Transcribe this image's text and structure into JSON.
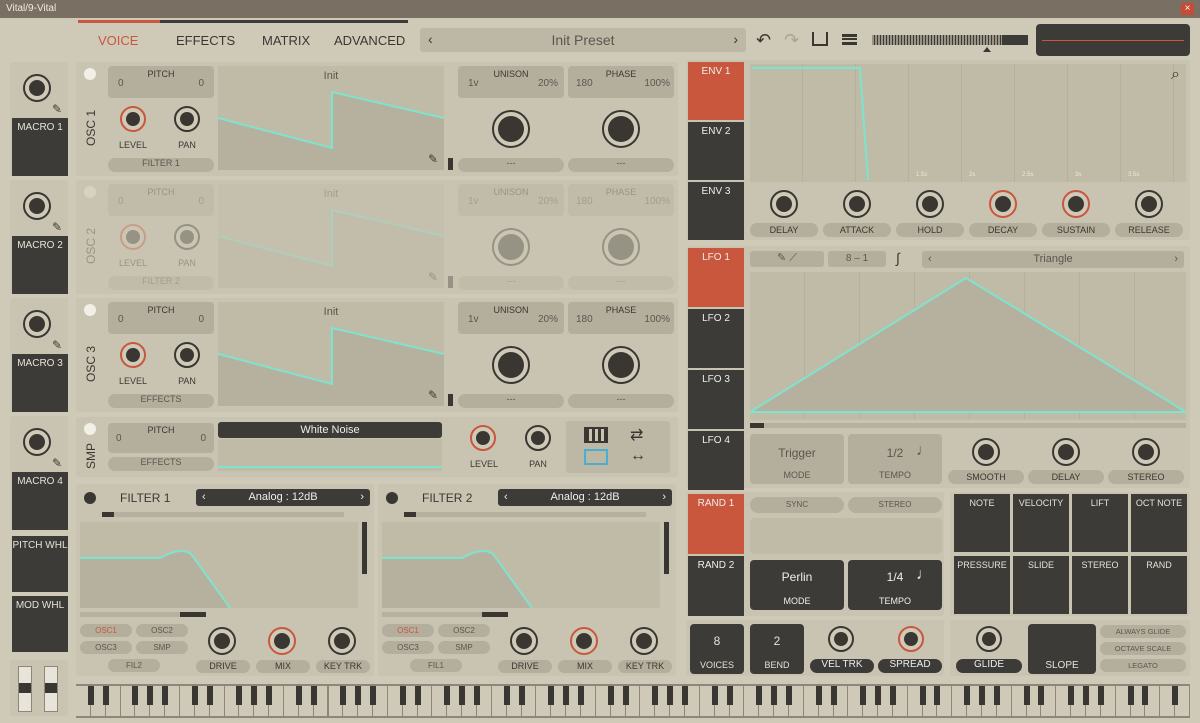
{
  "window": {
    "title": "Vital/9-Vital"
  },
  "header": {
    "tabs": [
      "VOICE",
      "EFFECTS",
      "MATRIX",
      "ADVANCED"
    ],
    "preset": "Init Preset"
  },
  "macros": [
    "MACRO 1",
    "MACRO 2",
    "MACRO 3",
    "MACRO 4",
    "PITCH WHL",
    "MOD WHL"
  ],
  "osc": [
    {
      "name": "OSC 1",
      "pitch_l": "0",
      "pitch_r": "0",
      "pitch_label": "PITCH",
      "wave": "Init",
      "mode": "2D",
      "level": "LEVEL",
      "pan": "PAN",
      "dest": "FILTER 1",
      "unison_v": "1v",
      "unison_label": "UNISON",
      "unison_pct": "20%",
      "phase_v": "180",
      "phase_label": "PHASE",
      "phase_pct": "100%",
      "sel1": "---",
      "sel2": "---"
    },
    {
      "name": "OSC 2",
      "pitch_l": "0",
      "pitch_r": "0",
      "pitch_label": "PITCH",
      "wave": "Init",
      "mode": "2D",
      "level": "LEVEL",
      "pan": "PAN",
      "dest": "FILTER 2",
      "unison_v": "1v",
      "unison_label": "UNISON",
      "unison_pct": "20%",
      "phase_v": "180",
      "phase_label": "PHASE",
      "phase_pct": "100%",
      "sel1": "---",
      "sel2": "---"
    },
    {
      "name": "OSC 3",
      "pitch_l": "0",
      "pitch_r": "0",
      "pitch_label": "PITCH",
      "wave": "Init",
      "mode": "2D",
      "level": "LEVEL",
      "pan": "PAN",
      "dest": "EFFECTS",
      "unison_v": "1v",
      "unison_label": "UNISON",
      "unison_pct": "20%",
      "phase_v": "180",
      "phase_label": "PHASE",
      "phase_pct": "100%",
      "sel1": "---",
      "sel2": "---"
    }
  ],
  "smp": {
    "name": "SMP",
    "pitch_l": "0",
    "pitch_r": "0",
    "pitch_label": "PITCH",
    "sample": "White Noise",
    "level": "LEVEL",
    "pan": "PAN",
    "dest": "EFFECTS"
  },
  "filters": [
    {
      "name": "FILTER 1",
      "type": "Analog : 12dB",
      "srcs": [
        "OSC1",
        "OSC2",
        "OSC3",
        "SMP"
      ],
      "fil": "FIL2",
      "drive": "DRIVE",
      "mix": "MIX",
      "keytrk": "KEY TRK"
    },
    {
      "name": "FILTER 2",
      "type": "Analog : 12dB",
      "srcs": [
        "OSC1",
        "OSC2",
        "OSC3",
        "SMP"
      ],
      "fil": "FIL1",
      "drive": "DRIVE",
      "mix": "MIX",
      "keytrk": "KEY TRK"
    }
  ],
  "env": {
    "tabs": [
      "ENV 1",
      "ENV 2",
      "ENV 3"
    ],
    "knobs": [
      "DELAY",
      "ATTACK",
      "HOLD",
      "DECAY",
      "SUSTAIN",
      "RELEASE"
    ],
    "ticks": [
      "1.5s",
      "2s",
      "2.5s",
      "3s",
      "3.5s"
    ]
  },
  "lfo": {
    "tabs": [
      "LFO 1",
      "LFO 2",
      "LFO 3",
      "LFO 4"
    ],
    "grid_a": "8",
    "grid_sep": "–",
    "grid_b": "1",
    "shape": "Triangle",
    "mode_val": "Trigger",
    "mode": "MODE",
    "tempo_val": "1/2",
    "tempo": "TEMPO",
    "knobs": [
      "SMOOTH",
      "DELAY",
      "STEREO"
    ]
  },
  "rand": {
    "tabs": [
      "RAND 1",
      "RAND 2"
    ],
    "sync": "SYNC",
    "stereo": "STEREO",
    "mode_val": "Perlin",
    "mode": "MODE",
    "tempo_val": "1/4",
    "tempo": "TEMPO"
  },
  "mods": [
    "NOTE",
    "VELOCITY",
    "LIFT",
    "OCT NOTE",
    "PRESSURE",
    "SLIDE",
    "STEREO",
    "RAND"
  ],
  "voice": {
    "voices_val": "8",
    "voices": "VOICES",
    "bend_val": "2",
    "bend": "BEND",
    "veltrk": "VEL TRK",
    "spread": "SPREAD",
    "glide": "GLIDE",
    "slope": "SLOPE",
    "always_glide": "ALWAYS GLIDE",
    "octave_scale": "OCTAVE SCALE",
    "legato": "LEGATO"
  },
  "colors": {
    "accent": "#c8573e",
    "wave": "#7ee3cf",
    "dark": "#3c3b38",
    "panel": "#c9c4b1"
  }
}
